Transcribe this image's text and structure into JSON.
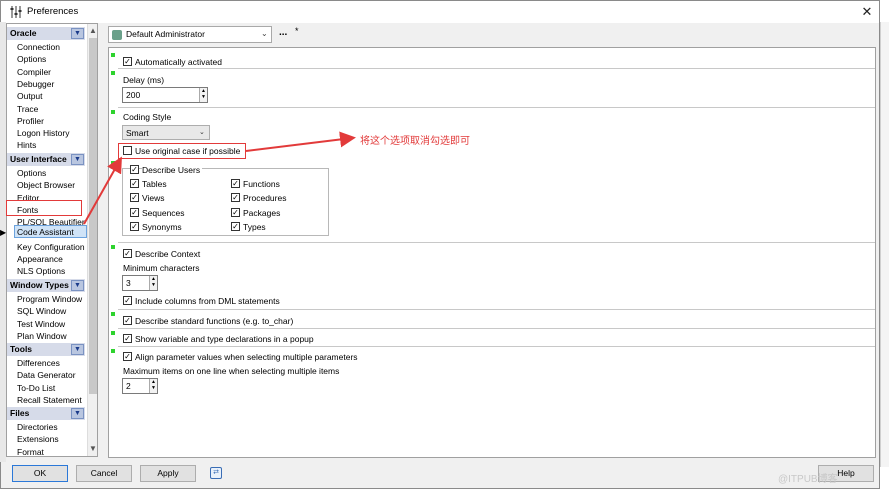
{
  "window": {
    "title": "Preferences",
    "close_glyph": "✕"
  },
  "sidebar": {
    "groups": [
      {
        "label": "Oracle",
        "items": [
          "Connection",
          "Options",
          "Compiler",
          "Debugger",
          "Output",
          "Trace",
          "Profiler",
          "Logon History",
          "Hints"
        ]
      },
      {
        "label": "User Interface",
        "items": [
          "Options",
          "Object Browser",
          "Editor",
          "Fonts",
          "PL/SQL Beautifier",
          "Code Assistant",
          "Key Configuration",
          "Appearance",
          "NLS Options"
        ]
      },
      {
        "label": "Window Types",
        "items": [
          "Program Window",
          "SQL Window",
          "Test Window",
          "Plan Window"
        ]
      },
      {
        "label": "Tools",
        "items": [
          "Differences",
          "Data Generator",
          "To-Do List",
          "Recall Statement"
        ]
      },
      {
        "label": "Files",
        "items": [
          "Directories",
          "Extensions",
          "Format"
        ]
      }
    ],
    "selected": "Code Assistant"
  },
  "header": {
    "profile": "Default Administrator",
    "dots": "...",
    "star": "*"
  },
  "settings": {
    "auto_activated": {
      "label": "Automatically activated",
      "checked": true
    },
    "delay": {
      "label": "Delay (ms)",
      "value": "200"
    },
    "coding_style": {
      "label": "Coding Style",
      "value": "Smart"
    },
    "use_original_case": {
      "label": "Use original case if possible",
      "checked": false
    },
    "describe_users": {
      "label": "Describe Users",
      "checked": true,
      "options": [
        "Tables",
        "Functions",
        "Views",
        "Procedures",
        "Sequences",
        "Packages",
        "Synonyms",
        "Types"
      ]
    },
    "describe_context": {
      "label": "Describe Context",
      "checked": true
    },
    "min_chars": {
      "label": "Minimum characters",
      "value": "3"
    },
    "include_dml": {
      "label": "Include columns from DML statements",
      "checked": true
    },
    "describe_std": {
      "label": "Describe standard functions (e.g. to_char)",
      "checked": true
    },
    "show_var": {
      "label": "Show variable and type declarations in a popup",
      "checked": true
    },
    "align_params": {
      "label": "Align parameter values when selecting multiple parameters",
      "checked": true
    },
    "max_items": {
      "label": "Maximum items on one line when selecting multiple items",
      "value": "2"
    }
  },
  "annotation": {
    "text": "将这个选项取消勾选即可",
    "color": "#e23a3a"
  },
  "footer": {
    "ok": "OK",
    "cancel": "Cancel",
    "apply": "Apply",
    "help": "Help"
  },
  "watermark": "@ITPUB博客"
}
